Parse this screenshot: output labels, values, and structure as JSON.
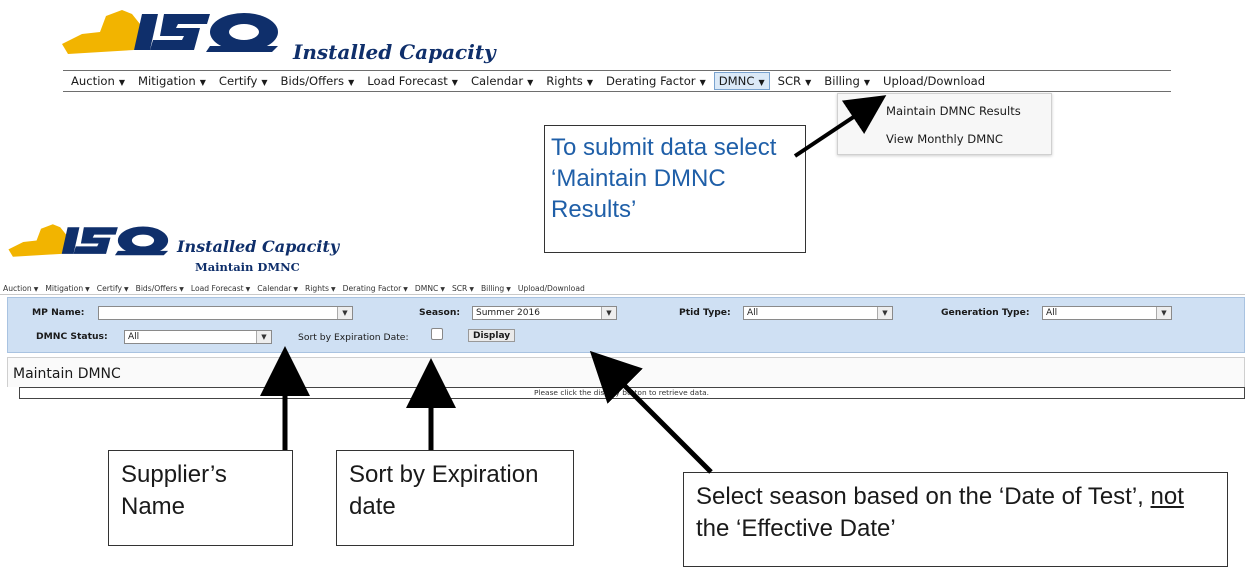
{
  "app": {
    "title": "Installed Capacity",
    "subtitle": "Maintain DMNC",
    "logo_text": "ISO"
  },
  "top_menu": {
    "items": [
      "Auction",
      "Mitigation",
      "Certify",
      "Bids/Offers",
      "Load Forecast",
      "Calendar",
      "Rights",
      "Derating Factor",
      "DMNC",
      "SCR",
      "Billing",
      "Upload/Download"
    ],
    "active": "DMNC"
  },
  "dmnc_dropdown": {
    "items": [
      "Maintain DMNC Results",
      "View Monthly DMNC"
    ]
  },
  "callouts": {
    "submit": "To submit data select ‘Maintain DMNC Results’",
    "supplier": "Supplier’s Name",
    "sort": "Sort by Expiration date",
    "season_prefix": "Select season based on the ‘Date of Test’, ",
    "season_not": "not",
    "season_suffix": " the ‘Effective Date’"
  },
  "filters": {
    "mp_name_label": "MP Name:",
    "mp_name_value": "",
    "season_label": "Season:",
    "season_value": "Summer 2016",
    "ptid_label": "Ptid Type:",
    "ptid_value": "All",
    "gen_type_label": "Generation Type:",
    "gen_type_value": "All",
    "dmnc_status_label": "DMNC Status:",
    "dmnc_status_value": "All",
    "sort_label": "Sort by Expiration Date:",
    "display_button": "Display"
  },
  "panel": {
    "title": "Maintain DMNC",
    "message": "Please click the display button to retrieve data."
  },
  "colors": {
    "brand_gold": "#f2b400",
    "brand_navy": "#0f2f6b",
    "callout_blue": "#1f5fa8",
    "filter_bg": "#cfe0f3"
  }
}
